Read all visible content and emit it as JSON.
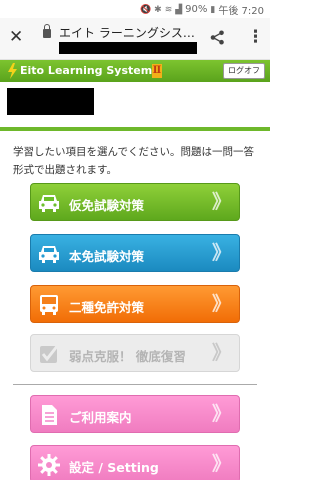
{
  "status_bar": {
    "battery": "90%",
    "time": "午後 7:20"
  },
  "url_bar": {
    "page_title": "エイト ラーニングシス…"
  },
  "header": {
    "logo_text": "Eito Learning System",
    "logo_roman": "Ⅱ",
    "logout_label": "ログオフ"
  },
  "instructions": "学習したい項目を選んでください。問題は一問一答形式で出題されます。",
  "menu": [
    {
      "label": "仮免試験対策",
      "enabled": true,
      "color": "#6cbf2a"
    },
    {
      "label": "本免試験対策",
      "enabled": true,
      "color": "#239bd2"
    },
    {
      "label": "二種免許対策",
      "enabled": true,
      "color": "#f5801a"
    },
    {
      "label": "弱点克服！ 徹底復習",
      "enabled": false,
      "color": "#ececec"
    },
    {
      "label": "ご利用案内",
      "enabled": true,
      "color": "#f58bcb"
    },
    {
      "label": "設定 / Setting",
      "enabled": true,
      "color": "#f58bcb"
    }
  ],
  "chevron": "》"
}
